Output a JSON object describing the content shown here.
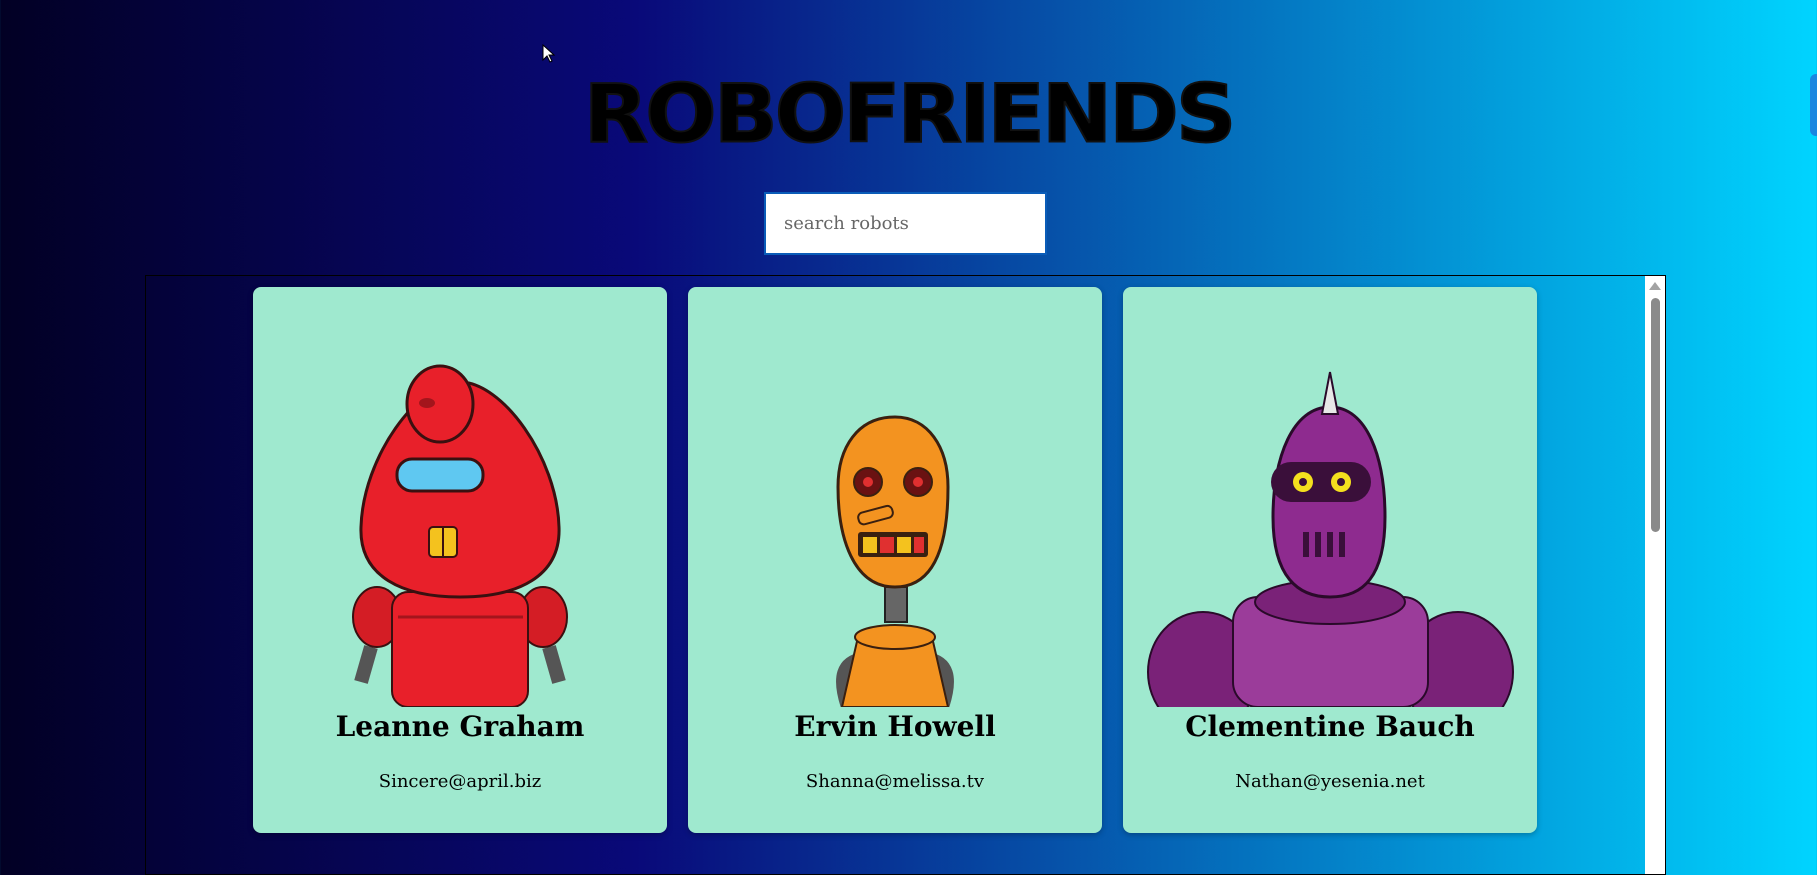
{
  "app": {
    "title": "ROBOFRIENDS",
    "search": {
      "placeholder": "search robots",
      "value": ""
    }
  },
  "cards": [
    {
      "name": "Leanne Graham",
      "email": "Sincere@april.biz",
      "robot_color": "#e8202a"
    },
    {
      "name": "Ervin Howell",
      "email": "Shanna@melissa.tv",
      "robot_color": "#f39320"
    },
    {
      "name": "Clementine Bauch",
      "email": "Nathan@yesenia.net",
      "robot_color": "#8e2b8f"
    }
  ],
  "colors": {
    "card_background": "#9fe9cf",
    "gradient_start": "#020024",
    "gradient_mid": "#090979",
    "gradient_end": "#00d4ff"
  }
}
